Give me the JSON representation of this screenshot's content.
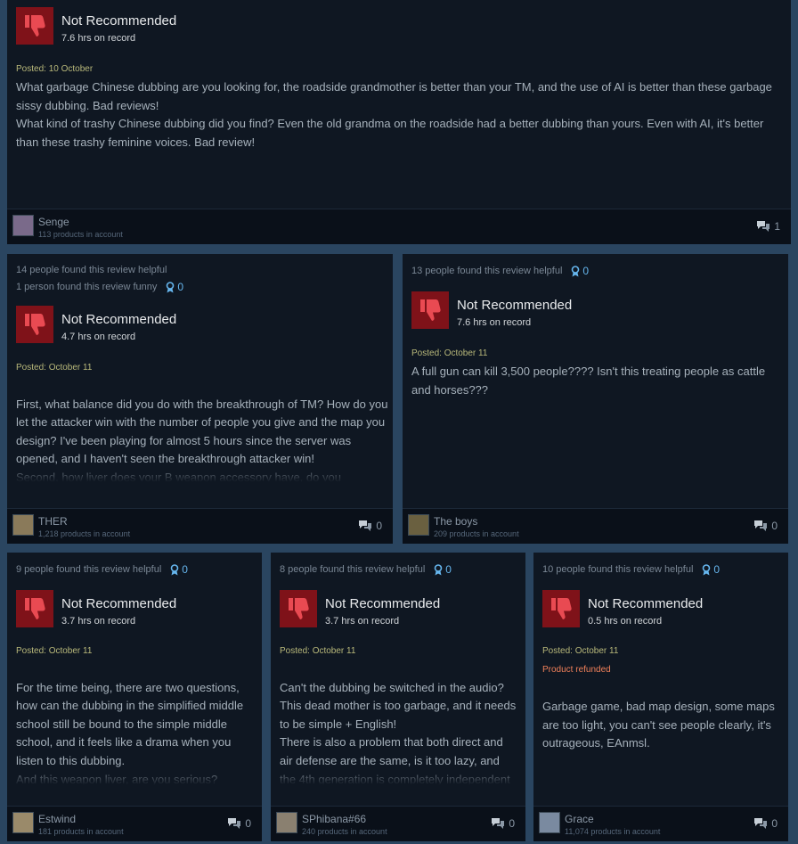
{
  "colors": {
    "page_background": "#2a4560",
    "card_background": "#0f1722",
    "not_recommended_badge": "#7f1219",
    "award_accent": "#66b6ee",
    "refunded_text": "#f0805a",
    "posted_text": "#b8b87a"
  },
  "icons": {
    "verdict": "thumbs-down-icon",
    "award": "award-ribbon-icon",
    "comments": "comment-bubbles-icon"
  },
  "reviews": [
    {
      "helpful": "",
      "funny": "",
      "award_count": "",
      "verdict": "Not Recommended",
      "hours": "7.6 hrs on record",
      "posted": "Posted: 10 October",
      "refunded": "",
      "text": "What garbage Chinese dubbing are you looking for, the roadside grandmother is better than your TM, and the use of AI is better than these garbage sissy dubbing. Bad reviews!\nWhat kind of trashy Chinese dubbing did you find? Even the old grandma on the roadside had a better dubbing than yours. Even with AI, it's better than these trashy feminine voices. Bad review!",
      "user": "Senge",
      "products": "113 products in account",
      "comments": "1",
      "avatar_color": "#7a6a8a"
    },
    {
      "helpful": "14 people found this review helpful",
      "funny": "1 person found this review funny",
      "award_count": "0",
      "verdict": "Not Recommended",
      "hours": "4.7 hrs on record",
      "posted": "Posted: October 11",
      "refunded": "",
      "text": "First, what balance did you do with the breakthrough of TM? How do you let the attacker win with the number of people you give and the map you design? I've been playing for almost 5 hours since the server was opened, and I haven't seen the breakthrough attacker win!\nSecond, how liver does your B weapon accessory have, do you",
      "user": "THER",
      "products": "1,218 products in account",
      "comments": "0",
      "avatar_color": "#8a7a5a"
    },
    {
      "helpful": "13 people found this review helpful",
      "funny": "",
      "award_count": "0",
      "verdict": "Not Recommended",
      "hours": "7.6 hrs on record",
      "posted": "Posted: October 11",
      "refunded": "",
      "text": "A full gun can kill 3,500 people???? Isn't this treating people as cattle and horses???",
      "user": "The boys",
      "products": "209 products in account",
      "comments": "0",
      "avatar_color": "#6a6040"
    },
    {
      "helpful": "9 people found this review helpful",
      "funny": "",
      "award_count": "0",
      "verdict": "Not Recommended",
      "hours": "3.7 hrs on record",
      "posted": "Posted: October 11",
      "refunded": "",
      "text": "For the time being, there are two questions, how can the dubbing in the simplified middle school still be bound to the simple middle school, and it feels like a drama when you listen to this dubbing.\nAnd this weapon liver, are you serious?\nThousands of kills are full of accessories, is",
      "user": "Estwind",
      "products": "181 products in account",
      "comments": "0",
      "avatar_color": "#9a8a6a"
    },
    {
      "helpful": "8 people found this review helpful",
      "funny": "",
      "award_count": "0",
      "verdict": "Not Recommended",
      "hours": "3.7 hrs on record",
      "posted": "Posted: October 11",
      "refunded": "",
      "text": "Can't the dubbing be switched in the audio? This dead mother is too garbage, and it needs to be simple + English!\nThere is also a problem that both direct and air defense are the same, is it too lazy, and the 4th generation is completely independent modeling",
      "user": "SPhibana#66",
      "products": "240 products in account",
      "comments": "0",
      "avatar_color": "#8a8070"
    },
    {
      "helpful": "10 people found this review helpful",
      "funny": "",
      "award_count": "0",
      "verdict": "Not Recommended",
      "hours": "0.5 hrs on record",
      "posted": "Posted: October 11",
      "refunded": "Product refunded",
      "text": "Garbage game, bad map design, some maps are too light, you can't see people clearly, it's outrageous, EAnmsl.",
      "user": "Grace",
      "products": "11,074 products in account",
      "comments": "0",
      "avatar_color": "#7a8aa0"
    }
  ]
}
